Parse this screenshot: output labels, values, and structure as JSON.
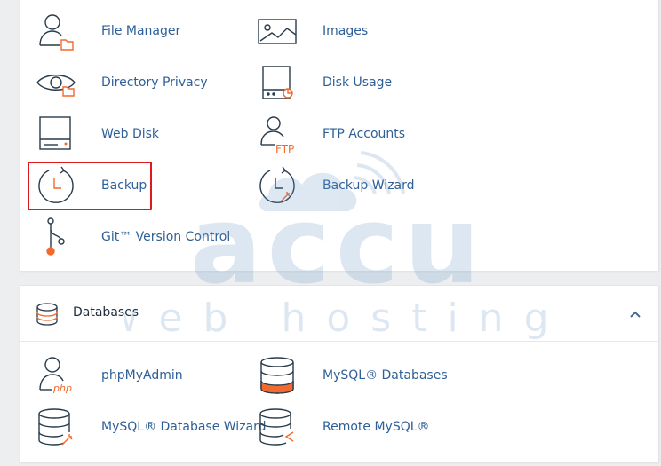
{
  "files": {
    "items": [
      {
        "label": "File Manager",
        "icon": "file-manager-icon"
      },
      {
        "label": "Images",
        "icon": "images-icon"
      },
      {
        "label": "Directory Privacy",
        "icon": "directory-privacy-icon"
      },
      {
        "label": "Disk Usage",
        "icon": "disk-usage-icon"
      },
      {
        "label": "Web Disk",
        "icon": "web-disk-icon"
      },
      {
        "label": "FTP Accounts",
        "icon": "ftp-accounts-icon",
        "icon_text": "FTP"
      },
      {
        "label": "Backup",
        "icon": "backup-icon"
      },
      {
        "label": "Backup Wizard",
        "icon": "backup-wizard-icon"
      },
      {
        "label": "Git™ Version Control",
        "icon": "git-icon"
      }
    ]
  },
  "databases": {
    "title": "Databases",
    "items": [
      {
        "label": "phpMyAdmin",
        "icon": "phpmyadmin-icon",
        "icon_text": "php"
      },
      {
        "label": "MySQL® Databases",
        "icon": "mysql-databases-icon"
      },
      {
        "label": "MySQL® Database Wizard",
        "icon": "mysql-wizard-icon"
      },
      {
        "label": "Remote MySQL®",
        "icon": "remote-mysql-icon"
      }
    ]
  },
  "watermark": {
    "line1": "accu",
    "line2": "web hosting"
  },
  "colors": {
    "link": "#2e5f97",
    "accent": "#f26a2e",
    "highlight": "#e01a1a",
    "icon_stroke": "#293a4a"
  }
}
